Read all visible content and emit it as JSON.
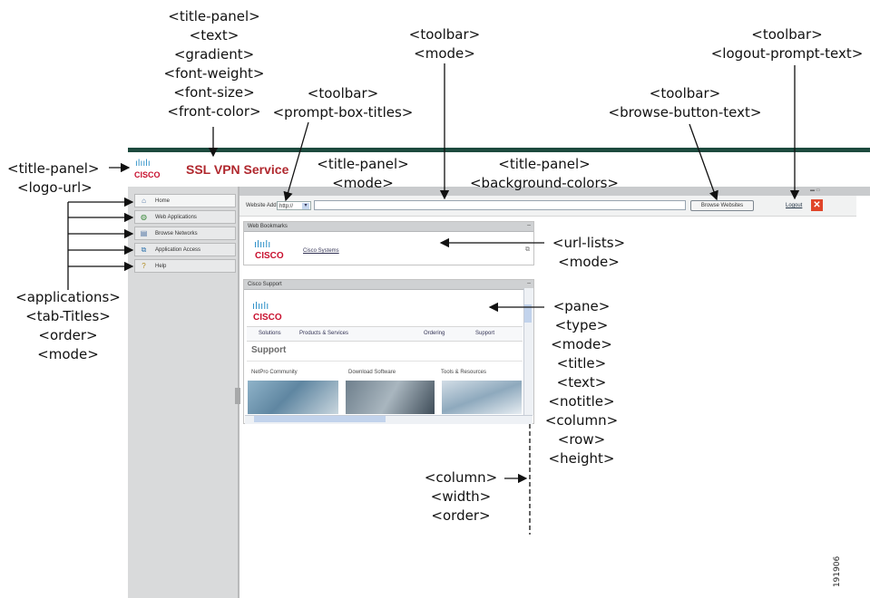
{
  "annotations": {
    "title_panel_props": [
      "<title-panel>",
      "<text>",
      "<gradient>",
      "<font-weight>",
      "<font-size>",
      "<front-color>"
    ],
    "toolbar_mode": [
      "<toolbar>",
      "<mode>"
    ],
    "toolbar_logout": [
      "<toolbar>",
      "<logout-prompt-text>"
    ],
    "toolbar_prompt": [
      "<toolbar>",
      "<prompt-box-titles>"
    ],
    "toolbar_browse": [
      "<toolbar>",
      "<browse-button-text>"
    ],
    "title_panel_logo": [
      "<title-panel>",
      "<logo-url>"
    ],
    "title_panel_mode": [
      "<title-panel>",
      "<mode>"
    ],
    "title_panel_bg": [
      "<title-panel>",
      "<background-colors>"
    ],
    "url_lists": [
      "<url-lists>",
      "<mode>"
    ],
    "applications": [
      "<applications>",
      "<tab-Titles>",
      "<order>",
      "<mode>"
    ],
    "pane": [
      "<pane>",
      "<type>",
      "<mode>",
      "<title>",
      "<text>",
      "<notitle>",
      "<column>",
      "<row>",
      "<height>"
    ],
    "column": [
      "<column>",
      "<width>",
      "<order>"
    ]
  },
  "brand": {
    "logo_bars": "ılıılı",
    "logo_word": "CISCO",
    "service_title": "SSL VPN Service"
  },
  "toolbar": {
    "website_address_label": "Website Address",
    "protocol_value": "http://",
    "url_value": "",
    "browse_button": "Browse Websites",
    "logout_text": "Logout"
  },
  "sidebar": {
    "items": [
      {
        "label": "Home",
        "icon": "home-icon"
      },
      {
        "label": "Web Applications",
        "icon": "globe-icon"
      },
      {
        "label": "Browse Networks",
        "icon": "network-icon"
      },
      {
        "label": "Application Access",
        "icon": "app-access-icon"
      },
      {
        "label": "Help",
        "icon": "help-icon"
      }
    ]
  },
  "panes": {
    "bookmarks": {
      "title": "Web Bookmarks",
      "link": "Cisco Systems"
    },
    "support": {
      "title": "Cisco Support",
      "tabs": [
        "Solutions",
        "Products & Services",
        "Ordering",
        "Support"
      ],
      "heading": "Support",
      "columns": [
        "NetPro Community",
        "Download Software",
        "Tools & Resources"
      ]
    }
  },
  "figure_id": "191906",
  "colors": {
    "title_bar": "#1d4a3e",
    "brand_red": "#b0282e",
    "cisco_blue": "#2b8fc7"
  }
}
